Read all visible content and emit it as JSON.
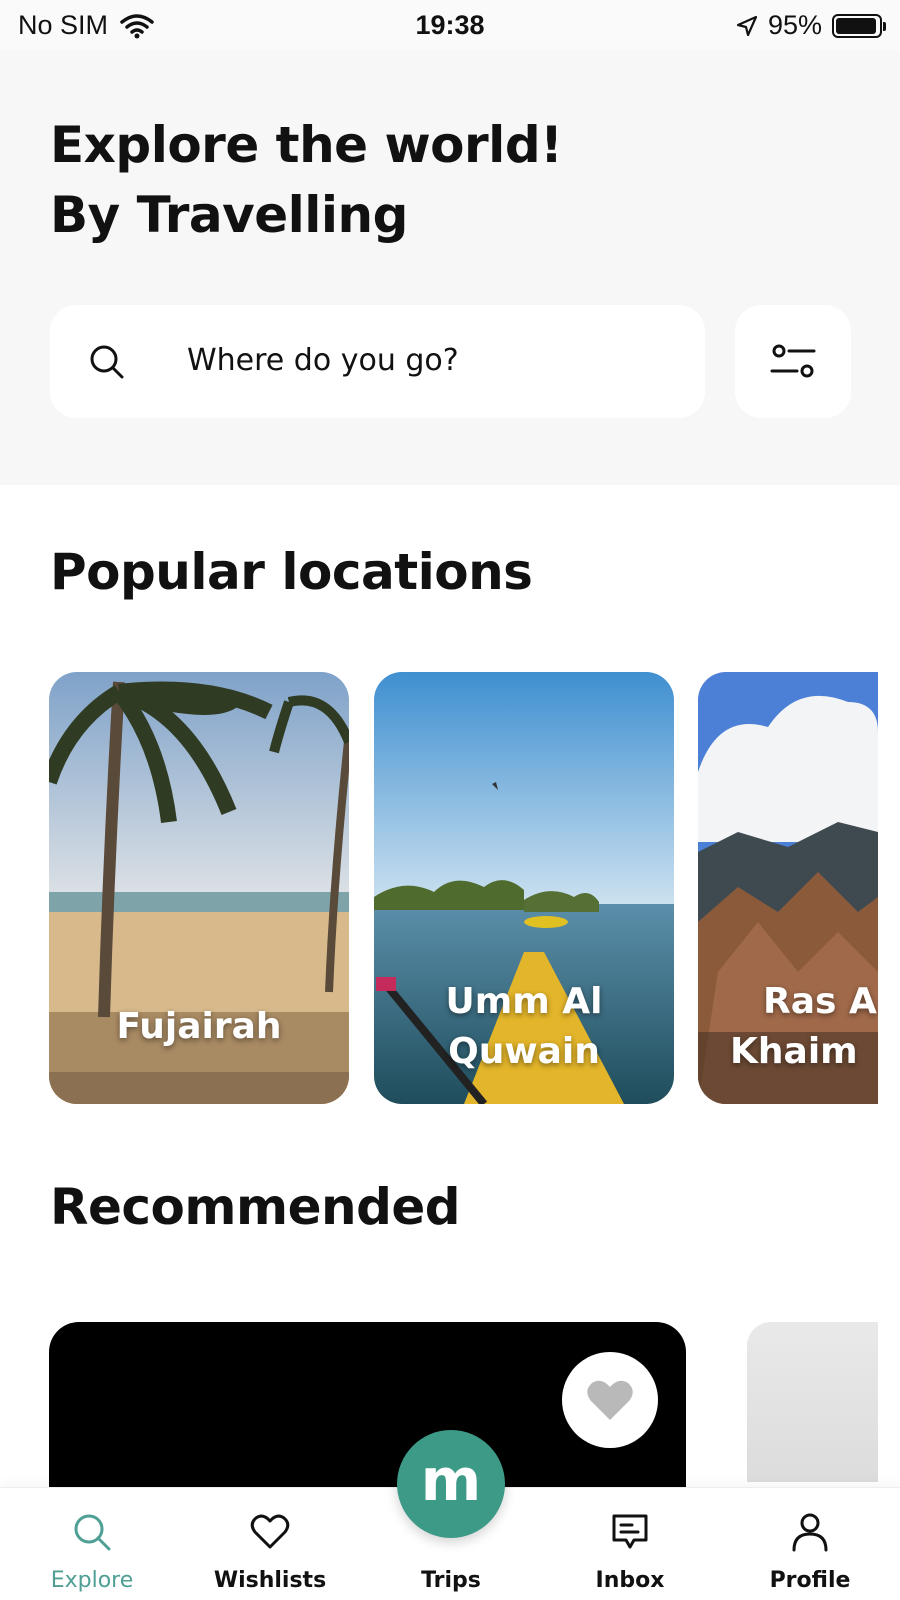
{
  "status_bar": {
    "carrier": "No SIM",
    "time": "19:38",
    "battery": "95%",
    "battery_level": 0.95
  },
  "hero": {
    "title_line1": "Explore the world!",
    "title_line2": "By Travelling"
  },
  "search": {
    "placeholder": "Where do you go?",
    "icon": "search-icon",
    "filter_icon": "filter-sliders-icon"
  },
  "popular": {
    "title": "Popular locations",
    "locations": [
      {
        "name": "Fujairah"
      },
      {
        "name": "Umm Al\nQuwain",
        "line1": "Umm Al",
        "line2": "Quwain"
      },
      {
        "name": "Ras Al Khaimah",
        "line1": "Ras A",
        "line2": "Khaim"
      }
    ]
  },
  "recommended": {
    "title": "Recommended",
    "favorite_icon": "heart-icon"
  },
  "nav": {
    "items": [
      {
        "label": "Explore",
        "icon": "search-icon",
        "active": true
      },
      {
        "label": "Wishlists",
        "icon": "heart-icon"
      },
      {
        "label": "Trips",
        "icon": "m-logo-icon"
      },
      {
        "label": "Inbox",
        "icon": "message-icon"
      },
      {
        "label": "Profile",
        "icon": "user-icon"
      }
    ],
    "fab_letter": "m"
  },
  "colors": {
    "accent": "#3d9a87",
    "active_nav": "#4f9f95",
    "hero_bg": "#f7f7f7"
  }
}
